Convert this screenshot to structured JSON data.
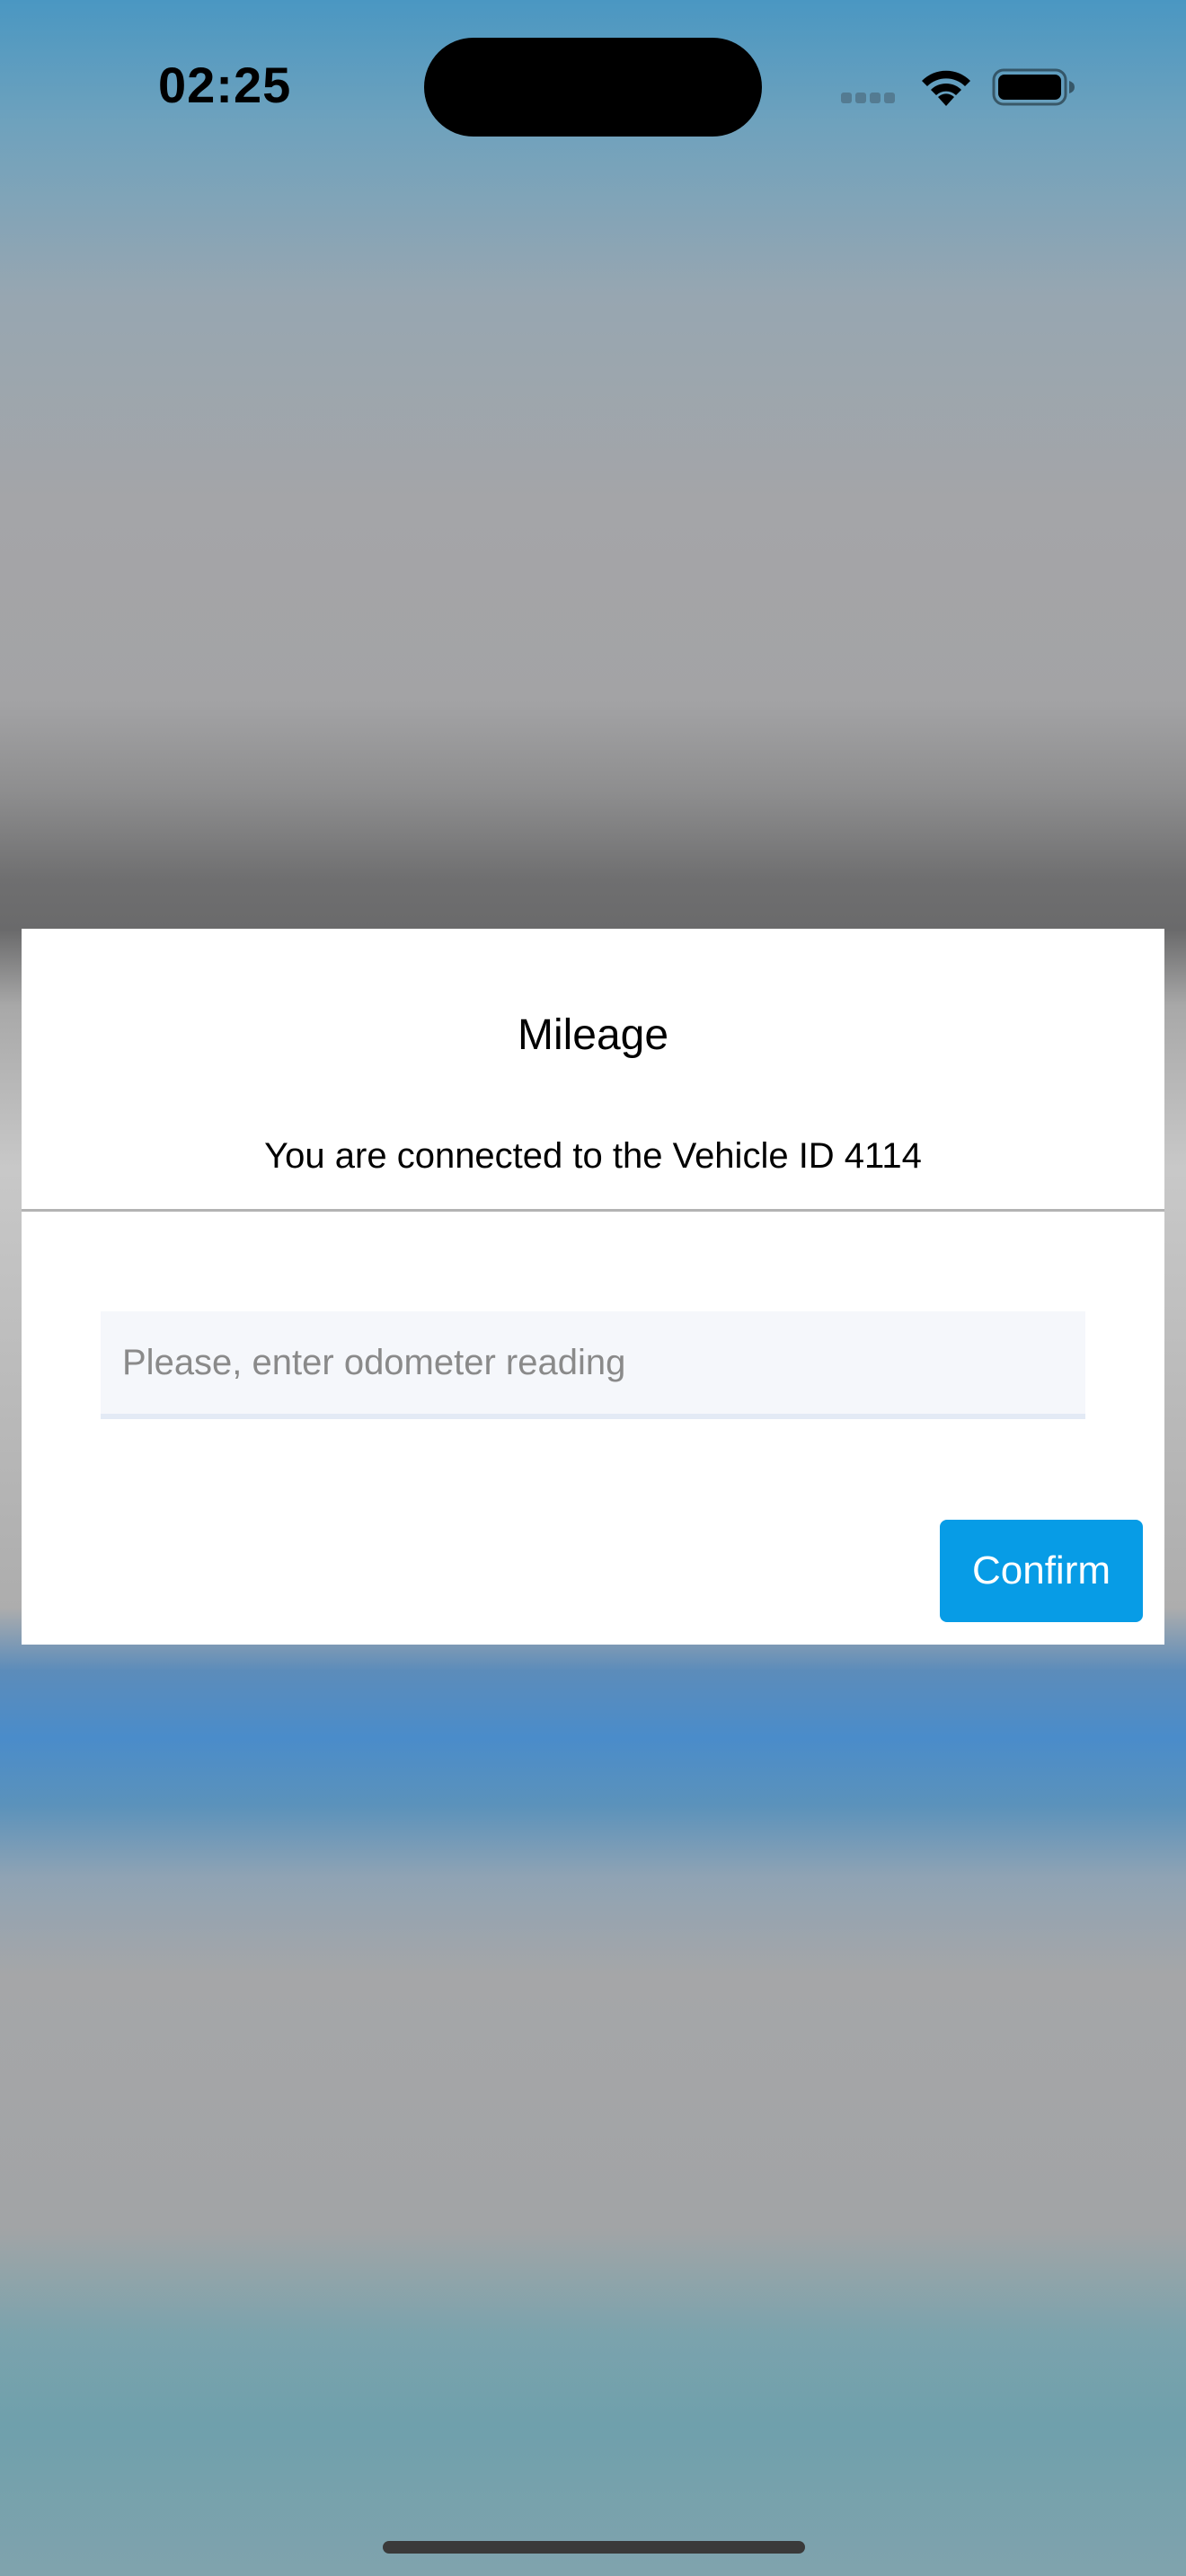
{
  "status_bar": {
    "time": "02:25",
    "icons": [
      "cellular-signal-icon",
      "wifi-icon",
      "battery-icon"
    ]
  },
  "dialog": {
    "title": "Mileage",
    "message": "You are connected to the Vehicle ID 4114",
    "odometer_input": {
      "value": "",
      "placeholder": "Please, enter odometer reading"
    },
    "confirm_label": "Confirm"
  },
  "colors": {
    "accent": "#079ce6",
    "dialog_background": "#ffffff",
    "input_background": "#f5f7fb",
    "divider": "#b3b3b3"
  }
}
